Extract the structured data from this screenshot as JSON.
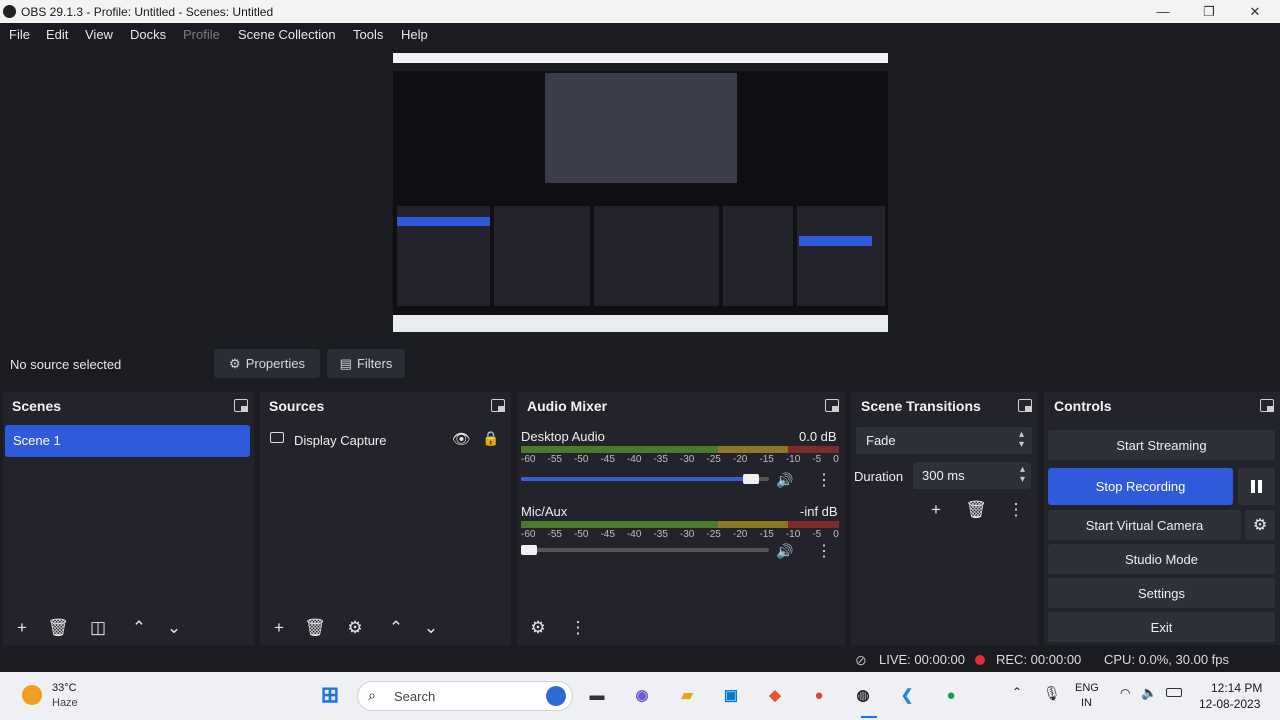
{
  "window": {
    "title": "OBS 29.1.3 - Profile: Untitled - Scenes: Untitled",
    "minimize": "—",
    "maximize": "❐",
    "close": "✕"
  },
  "menu": [
    "File",
    "Edit",
    "View",
    "Docks",
    "Profile",
    "Scene Collection",
    "Tools",
    "Help"
  ],
  "source_bar": {
    "status": "No source selected",
    "properties_label": "Properties",
    "filters_label": "Filters"
  },
  "scenes": {
    "title": "Scenes",
    "items": [
      "Scene 1"
    ]
  },
  "sources": {
    "title": "Sources",
    "items": [
      "Display Capture"
    ]
  },
  "audio_mixer": {
    "title": "Audio Mixer",
    "ticks": [
      "-60",
      "-55",
      "-50",
      "-45",
      "-40",
      "-35",
      "-30",
      "-25",
      "-20",
      "-15",
      "-10",
      "-5",
      "0"
    ],
    "channels": [
      {
        "name": "Desktop Audio",
        "level": "0.0 dB",
        "volume": 0.96
      },
      {
        "name": "Mic/Aux",
        "level": "-inf dB",
        "volume": 0.04
      }
    ]
  },
  "transitions": {
    "title": "Scene Transitions",
    "selected": "Fade",
    "duration_label": "Duration",
    "duration_value": "300 ms"
  },
  "controls": {
    "title": "Controls",
    "start_streaming": "Start Streaming",
    "stop_recording": "Stop Recording",
    "start_virtual_camera": "Start Virtual Camera",
    "studio_mode": "Studio Mode",
    "settings": "Settings",
    "exit": "Exit"
  },
  "status": {
    "live": "LIVE: 00:00:00",
    "rec": "REC: 00:00:00",
    "cpu": "CPU: 0.0%, 30.00 fps"
  },
  "taskbar": {
    "weather_temp": "33°C",
    "weather_desc": "Haze",
    "search_placeholder": "Search",
    "lang_top": "ENG",
    "lang_bottom": "IN",
    "time": "12:14 PM",
    "date": "12-08-2023"
  },
  "colors": {
    "accent": "#2f5ad9",
    "rec": "#e03030",
    "panel": "#23242b",
    "background": "#1b1c22"
  }
}
